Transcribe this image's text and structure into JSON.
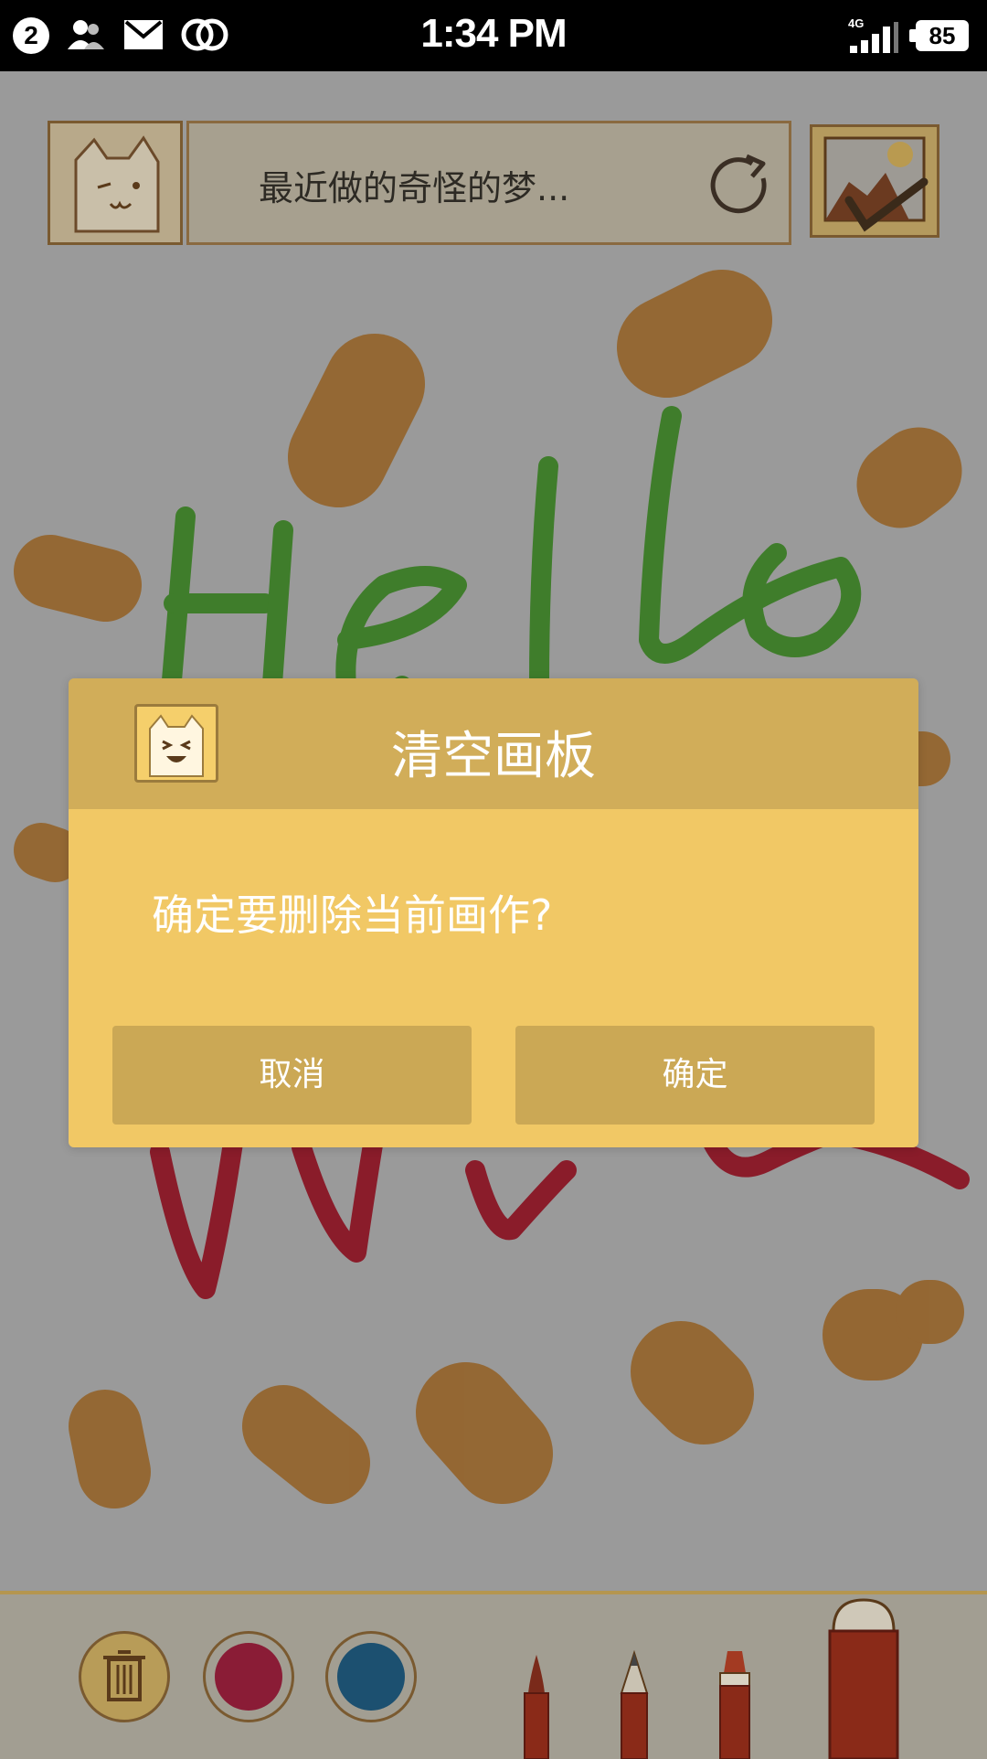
{
  "status_bar": {
    "notification_count": "2",
    "time": "1:34 PM",
    "network": "4G",
    "battery": "85",
    "icons": [
      "contacts-icon",
      "mail-icon",
      "link-icon",
      "signal-icon",
      "battery-icon"
    ]
  },
  "header": {
    "title": "最近做的奇怪的梦...",
    "icons": [
      "cat-avatar-icon",
      "refresh-icon",
      "gallery-icon"
    ]
  },
  "canvas": {
    "colors": {
      "orange": "#94652e",
      "green": "#3f7d2b",
      "red": "#8a1c2a",
      "dim": "#9a9a9a"
    }
  },
  "toolbar": {
    "icons": [
      "trash-icon",
      "red-color-swatch",
      "blue-color-swatch",
      "brush-icon",
      "pencil-icon",
      "marker-icon",
      "crayon-icon"
    ],
    "colors": {
      "swatch_red": "#8a1c36",
      "swatch_blue": "#1c5070"
    }
  },
  "dialog": {
    "title": "清空画板",
    "message": "确定要删除当前画作?",
    "cancel_label": "取消",
    "confirm_label": "确定",
    "colors": {
      "header": "#d1ad59",
      "body": "#f1c865",
      "button": "#cba855"
    }
  }
}
